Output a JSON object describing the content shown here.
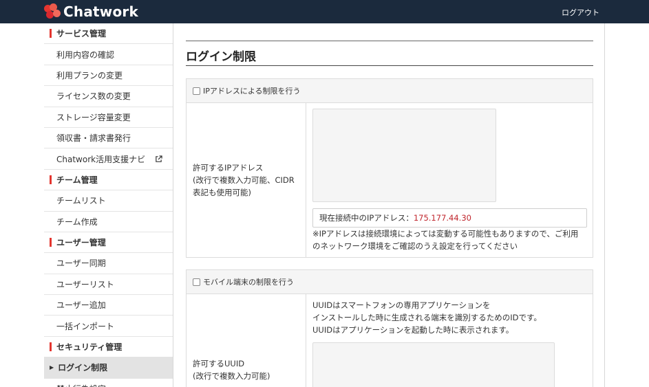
{
  "header": {
    "brand": "Chatwork",
    "logout": "ログアウト"
  },
  "sidebar": {
    "rows": [
      {
        "kind": "head",
        "label": "サービス管理"
      },
      {
        "kind": "item",
        "label": "利用内容の確認"
      },
      {
        "kind": "item",
        "label": "利用プランの変更"
      },
      {
        "kind": "item",
        "label": "ライセンス数の変更"
      },
      {
        "kind": "item",
        "label": "ストレージ容量変更"
      },
      {
        "kind": "item",
        "label": "領収書・請求書発行"
      },
      {
        "kind": "item",
        "label": "Chatwork活用支援ナビ"
      },
      {
        "kind": "head",
        "label": "チーム管理"
      },
      {
        "kind": "item",
        "label": "チームリスト"
      },
      {
        "kind": "item",
        "label": "チーム作成"
      },
      {
        "kind": "head",
        "label": "ユーザー管理"
      },
      {
        "kind": "item",
        "label": "ユーザー同期"
      },
      {
        "kind": "item",
        "label": "ユーザーリスト"
      },
      {
        "kind": "item",
        "label": "ユーザー追加"
      },
      {
        "kind": "item",
        "label": "一括インポート"
      },
      {
        "kind": "head",
        "label": "セキュリティ管理"
      },
      {
        "kind": "active",
        "label": "ログイン制限"
      },
      {
        "kind": "item",
        "label": "禁止行為設定"
      }
    ]
  },
  "main": {
    "title": "ログイン制限",
    "ip_section": {
      "checkbox_label": "IPアドレスによる制限を行う",
      "field_label_1": "許可するIPアドレス",
      "field_label_2": "(改行で複数入力可能、CIDR",
      "field_label_3": "表記も使用可能)",
      "current_ip_label": "現在接続中のIPアドレス：",
      "current_ip_value": "175.177.44.30",
      "note_1": "※IPアドレスは接続環境によっては変動する可能性もありますので、ご利用",
      "note_2": "のネットワーク環境をご確認のうえ設定を行ってください"
    },
    "mobile_section": {
      "checkbox_label": "モバイル端末の制限を行う",
      "desc_1": "UUIDはスマートフォンの専用アプリケーションを",
      "desc_2": "インストールした時に生成される端末を識別するためのIDです。",
      "desc_3": "UUIDはアプリケーションを起動した時に表示されます。",
      "field_label_1": "許可するUUID",
      "field_label_2": "(改行で複数入力可能)"
    }
  },
  "colors": {
    "header_bg": "#1b2a3d",
    "accent": "#e4352f",
    "ip_value": "#c0262d"
  },
  "icons": {
    "logo": "chatwork-logo-icon",
    "external": "external-link-icon",
    "active_marker": "triangle-right-icon"
  }
}
